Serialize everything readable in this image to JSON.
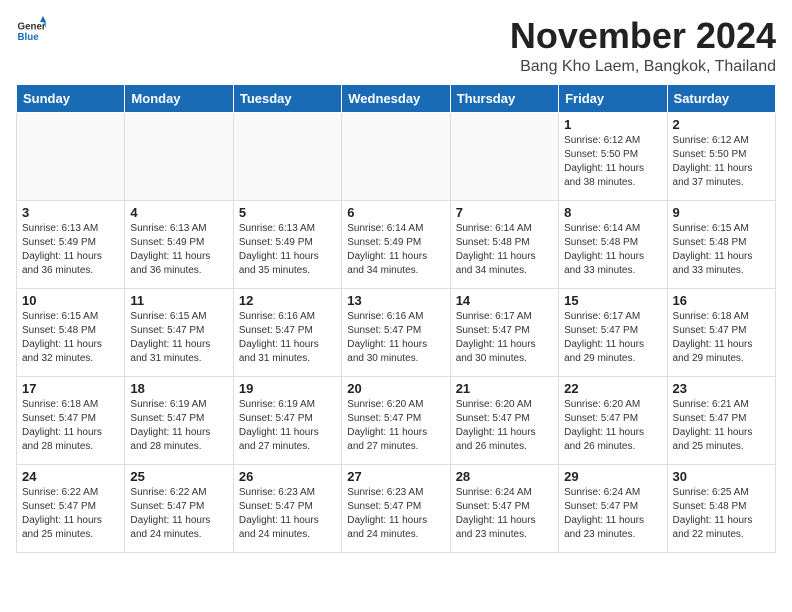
{
  "logo": {
    "text_general": "General",
    "text_blue": "Blue"
  },
  "title": "November 2024",
  "location": "Bang Kho Laem, Bangkok, Thailand",
  "days_of_week": [
    "Sunday",
    "Monday",
    "Tuesday",
    "Wednesday",
    "Thursday",
    "Friday",
    "Saturday"
  ],
  "weeks": [
    [
      {
        "day": "",
        "info": ""
      },
      {
        "day": "",
        "info": ""
      },
      {
        "day": "",
        "info": ""
      },
      {
        "day": "",
        "info": ""
      },
      {
        "day": "",
        "info": ""
      },
      {
        "day": "1",
        "info": "Sunrise: 6:12 AM\nSunset: 5:50 PM\nDaylight: 11 hours\nand 38 minutes."
      },
      {
        "day": "2",
        "info": "Sunrise: 6:12 AM\nSunset: 5:50 PM\nDaylight: 11 hours\nand 37 minutes."
      }
    ],
    [
      {
        "day": "3",
        "info": "Sunrise: 6:13 AM\nSunset: 5:49 PM\nDaylight: 11 hours\nand 36 minutes."
      },
      {
        "day": "4",
        "info": "Sunrise: 6:13 AM\nSunset: 5:49 PM\nDaylight: 11 hours\nand 36 minutes."
      },
      {
        "day": "5",
        "info": "Sunrise: 6:13 AM\nSunset: 5:49 PM\nDaylight: 11 hours\nand 35 minutes."
      },
      {
        "day": "6",
        "info": "Sunrise: 6:14 AM\nSunset: 5:49 PM\nDaylight: 11 hours\nand 34 minutes."
      },
      {
        "day": "7",
        "info": "Sunrise: 6:14 AM\nSunset: 5:48 PM\nDaylight: 11 hours\nand 34 minutes."
      },
      {
        "day": "8",
        "info": "Sunrise: 6:14 AM\nSunset: 5:48 PM\nDaylight: 11 hours\nand 33 minutes."
      },
      {
        "day": "9",
        "info": "Sunrise: 6:15 AM\nSunset: 5:48 PM\nDaylight: 11 hours\nand 33 minutes."
      }
    ],
    [
      {
        "day": "10",
        "info": "Sunrise: 6:15 AM\nSunset: 5:48 PM\nDaylight: 11 hours\nand 32 minutes."
      },
      {
        "day": "11",
        "info": "Sunrise: 6:15 AM\nSunset: 5:47 PM\nDaylight: 11 hours\nand 31 minutes."
      },
      {
        "day": "12",
        "info": "Sunrise: 6:16 AM\nSunset: 5:47 PM\nDaylight: 11 hours\nand 31 minutes."
      },
      {
        "day": "13",
        "info": "Sunrise: 6:16 AM\nSunset: 5:47 PM\nDaylight: 11 hours\nand 30 minutes."
      },
      {
        "day": "14",
        "info": "Sunrise: 6:17 AM\nSunset: 5:47 PM\nDaylight: 11 hours\nand 30 minutes."
      },
      {
        "day": "15",
        "info": "Sunrise: 6:17 AM\nSunset: 5:47 PM\nDaylight: 11 hours\nand 29 minutes."
      },
      {
        "day": "16",
        "info": "Sunrise: 6:18 AM\nSunset: 5:47 PM\nDaylight: 11 hours\nand 29 minutes."
      }
    ],
    [
      {
        "day": "17",
        "info": "Sunrise: 6:18 AM\nSunset: 5:47 PM\nDaylight: 11 hours\nand 28 minutes."
      },
      {
        "day": "18",
        "info": "Sunrise: 6:19 AM\nSunset: 5:47 PM\nDaylight: 11 hours\nand 28 minutes."
      },
      {
        "day": "19",
        "info": "Sunrise: 6:19 AM\nSunset: 5:47 PM\nDaylight: 11 hours\nand 27 minutes."
      },
      {
        "day": "20",
        "info": "Sunrise: 6:20 AM\nSunset: 5:47 PM\nDaylight: 11 hours\nand 27 minutes."
      },
      {
        "day": "21",
        "info": "Sunrise: 6:20 AM\nSunset: 5:47 PM\nDaylight: 11 hours\nand 26 minutes."
      },
      {
        "day": "22",
        "info": "Sunrise: 6:20 AM\nSunset: 5:47 PM\nDaylight: 11 hours\nand 26 minutes."
      },
      {
        "day": "23",
        "info": "Sunrise: 6:21 AM\nSunset: 5:47 PM\nDaylight: 11 hours\nand 25 minutes."
      }
    ],
    [
      {
        "day": "24",
        "info": "Sunrise: 6:22 AM\nSunset: 5:47 PM\nDaylight: 11 hours\nand 25 minutes."
      },
      {
        "day": "25",
        "info": "Sunrise: 6:22 AM\nSunset: 5:47 PM\nDaylight: 11 hours\nand 24 minutes."
      },
      {
        "day": "26",
        "info": "Sunrise: 6:23 AM\nSunset: 5:47 PM\nDaylight: 11 hours\nand 24 minutes."
      },
      {
        "day": "27",
        "info": "Sunrise: 6:23 AM\nSunset: 5:47 PM\nDaylight: 11 hours\nand 24 minutes."
      },
      {
        "day": "28",
        "info": "Sunrise: 6:24 AM\nSunset: 5:47 PM\nDaylight: 11 hours\nand 23 minutes."
      },
      {
        "day": "29",
        "info": "Sunrise: 6:24 AM\nSunset: 5:47 PM\nDaylight: 11 hours\nand 23 minutes."
      },
      {
        "day": "30",
        "info": "Sunrise: 6:25 AM\nSunset: 5:48 PM\nDaylight: 11 hours\nand 22 minutes."
      }
    ]
  ]
}
